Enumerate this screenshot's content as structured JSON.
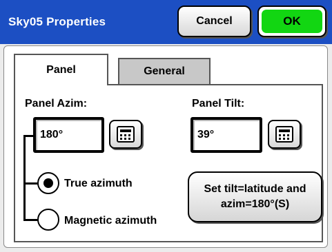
{
  "window": {
    "title": "Sky05 Properties",
    "cancel_label": "Cancel",
    "ok_label": "OK",
    "titlebar_color": "#1c4fc3",
    "ok_color": "#12d612"
  },
  "tabs": [
    {
      "label": "Panel",
      "selected": true
    },
    {
      "label": "General",
      "selected": false
    }
  ],
  "panel": {
    "azim_label": "Panel Azim:",
    "azim_value": "180°",
    "tilt_label": "Panel Tilt:",
    "tilt_value": "39°",
    "radio_true_label": "True azimuth",
    "radio_magnetic_label": "Magnetic azimuth",
    "selected_radio": "True azimuth",
    "set_tilt_line1": "Set tilt=latitude and",
    "set_tilt_line2": "azim=180°(S)",
    "calculator_icon": "calculator-icon"
  }
}
